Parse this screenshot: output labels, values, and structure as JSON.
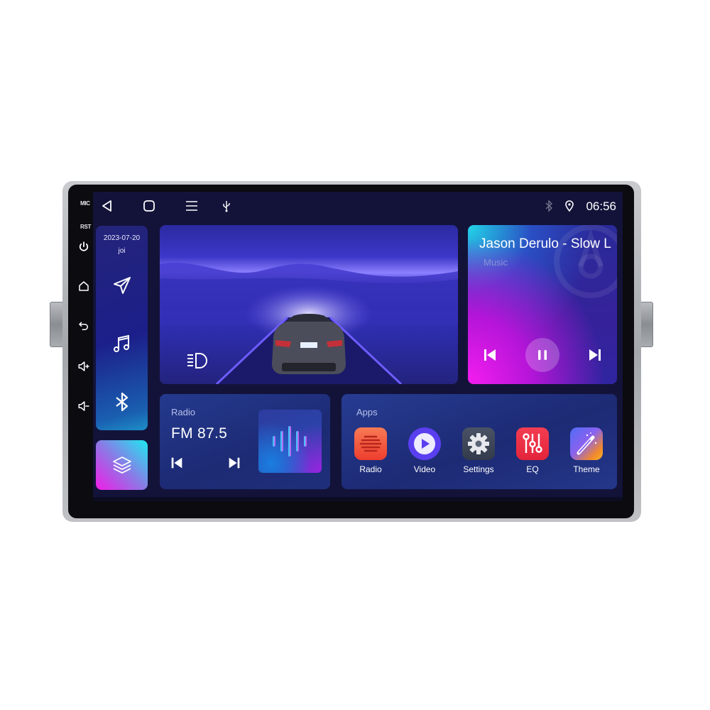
{
  "device": {
    "hw_labels": {
      "mic": "MIC",
      "rst": "RST"
    },
    "hw_buttons": [
      {
        "name": "power",
        "icon": "power-icon"
      },
      {
        "name": "home",
        "icon": "home-icon"
      },
      {
        "name": "back",
        "icon": "back-arrow-icon"
      },
      {
        "name": "volume-up",
        "icon": "volume-up-icon"
      },
      {
        "name": "volume-down",
        "icon": "volume-down-icon"
      }
    ]
  },
  "status_bar": {
    "nav": [
      {
        "name": "back",
        "icon": "triangle-back-icon"
      },
      {
        "name": "home",
        "icon": "square-home-icon"
      },
      {
        "name": "menu",
        "icon": "hamburger-menu-icon"
      },
      {
        "name": "usb",
        "icon": "usb-icon"
      }
    ],
    "indicators": [
      "bluetooth-icon",
      "location-pin-icon"
    ],
    "time": "06:56"
  },
  "sidebar": {
    "date": "2023-07-20",
    "day": "joi",
    "buttons": [
      {
        "name": "navigation",
        "icon": "navigation-arrow-icon"
      },
      {
        "name": "music",
        "icon": "music-note-icon"
      },
      {
        "name": "bluetooth",
        "icon": "bluetooth-icon"
      }
    ],
    "layers_button": {
      "icon": "layers-icon"
    }
  },
  "car_widget": {
    "icon": "headlight-icon"
  },
  "music_widget": {
    "title": "Jason Derulo - Slow L",
    "subtitle": "Music",
    "controls": [
      "previous",
      "pause",
      "next"
    ]
  },
  "radio_widget": {
    "label": "Radio",
    "frequency": "FM  87.5",
    "controls": [
      "previous",
      "next"
    ]
  },
  "apps_widget": {
    "label": "Apps",
    "apps": [
      {
        "label": "Radio",
        "icon": "radio-app-icon",
        "color": "#f2583e"
      },
      {
        "label": "Video",
        "icon": "video-app-icon",
        "color": "#5a3ff0"
      },
      {
        "label": "Settings",
        "icon": "settings-app-icon",
        "color": "#3e4658"
      },
      {
        "label": "EQ",
        "icon": "eq-app-icon",
        "color": "#ee2f45"
      },
      {
        "label": "Theme",
        "icon": "theme-app-icon",
        "color": "#7b62f2"
      }
    ]
  },
  "colors": {
    "screen_bg": "#13133a",
    "accent_cyan": "#1de9f0",
    "accent_magenta": "#f21ce6",
    "card_blue": "#1d2a74"
  }
}
